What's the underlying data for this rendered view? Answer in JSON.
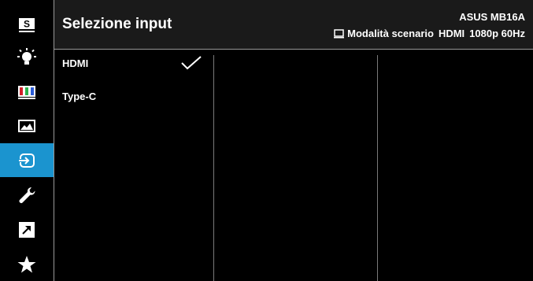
{
  "header": {
    "title": "Selezione input",
    "model": "ASUS MB16A",
    "status_mode": "Modalità scenario",
    "status_input": "HDMI",
    "status_resolution": "1080p 60Hz"
  },
  "sidebar": {
    "active_index": 4,
    "items": [
      {
        "icon": "splendid-s-icon",
        "label": "S"
      },
      {
        "icon": "bluelight-bulb-icon"
      },
      {
        "icon": "color-bars-icon"
      },
      {
        "icon": "image-icon"
      },
      {
        "icon": "input-select-icon"
      },
      {
        "icon": "system-setup-wrench-icon"
      },
      {
        "icon": "shortcut-arrow-icon"
      },
      {
        "icon": "favorite-star-icon"
      }
    ]
  },
  "input_options": [
    {
      "label": "HDMI",
      "selected": true
    },
    {
      "label": "Type-C",
      "selected": false
    }
  ],
  "colors": {
    "active_accent": "#1b94cf",
    "background": "#000000",
    "header_bg": "#1a1a1a",
    "text": "#ffffff"
  }
}
